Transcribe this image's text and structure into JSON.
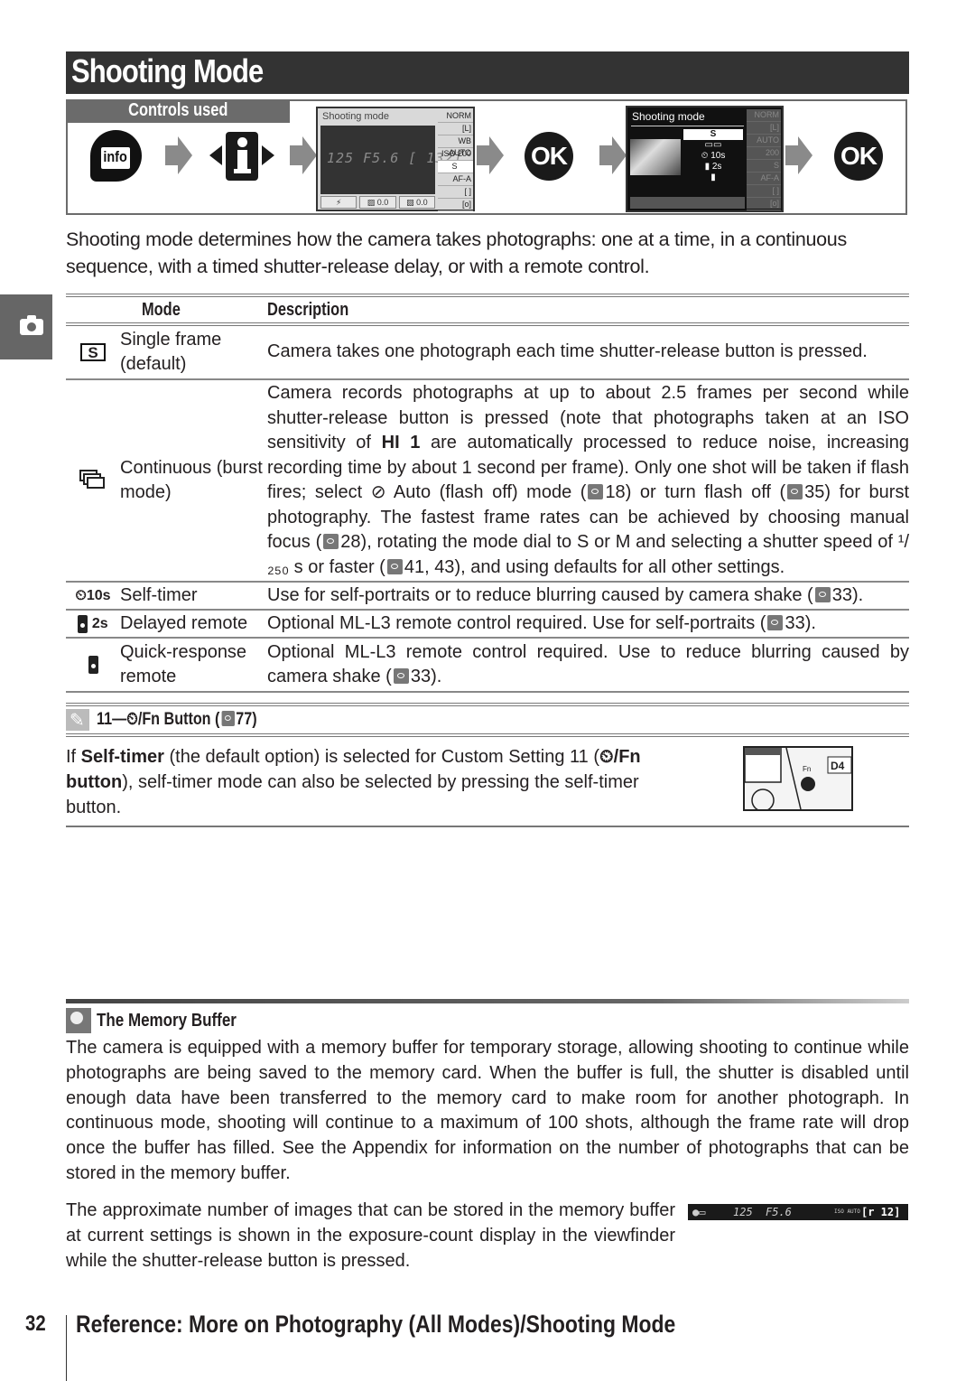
{
  "page": {
    "title": "Shooting Mode",
    "controls_label": "Controls used",
    "intro": "Shooting mode determines how the camera takes photographs: one at a time, in a continuous sequence, with a timed shutter-release delay, or with a remote control.",
    "side_tab_icon": "camera-icon"
  },
  "controls": {
    "info_button": "info",
    "ok_button_1": "OK",
    "ok_button_2": "OK",
    "screen1": {
      "header": "Shooting mode",
      "digits": "125  F5.6 [ 132]",
      "side": [
        "NORM",
        "[L]",
        "WB AUTO",
        "ISO 200",
        "S",
        "AF-A",
        "[ ]",
        "[o]"
      ],
      "bottom": [
        "⚡",
        "▨ 0.0",
        "▨ 0.0"
      ]
    },
    "screen2": {
      "header": "Shooting mode",
      "menu": [
        "S",
        "▭▭",
        "⏲ 10s",
        "▮ 2s",
        "▮"
      ],
      "side": [
        "NORM",
        "[L]",
        "AUTO",
        "200",
        "S",
        "AF-A",
        "[ ]",
        "[o]"
      ]
    }
  },
  "table": {
    "headers": {
      "mode": "Mode",
      "description": "Description"
    },
    "rows": [
      {
        "icon": "S",
        "icon_name": "single-frame-icon",
        "mode": "Single frame (default)",
        "description": "Camera takes one photograph each time shutter-release button is pressed."
      },
      {
        "icon": "",
        "icon_name": "continuous-icon",
        "mode": "Continuous (burst mode)",
        "description_parts": {
          "p1": "Camera records photographs at up to about 2.5 frames per second while shutter-release button is pressed (note that photographs taken at an ISO sensitivity of ",
          "bold1": "HI 1",
          "p2": " are automatically processed to reduce noise, increasing recording time by about 1 second per frame). Only one shot will be taken if flash fires; select ",
          "p3": " Auto (flash off) mode (",
          "ref1": "18",
          "p4": ") or turn flash off (",
          "ref2": "35",
          "p5": ") for burst photography. The fastest frame rates can be achieved by choosing manual focus (",
          "ref3": "28",
          "p6": "), rotating the mode dial to ",
          "s": "S",
          "p7": " or ",
          "m": "M",
          "p8": " and selecting a shutter speed of ",
          "speed": "¹/₂₅₀ s",
          "p9": " or faster (",
          "ref4": "41, 43",
          "p10": "), and using defaults for all other settings."
        }
      },
      {
        "icon": "⏲10s",
        "icon_name": "self-timer-icon",
        "mode": "Self-timer",
        "description": "Use for self-portraits or to reduce blurring caused by camera shake (",
        "ref": "33",
        "tail": ")."
      },
      {
        "icon": "2s",
        "icon_name": "delayed-remote-icon",
        "mode": "Delayed remote",
        "description": "Optional ML-L3 remote control required. Use for self-portraits (",
        "ref": "33",
        "tail": ")."
      },
      {
        "icon": "",
        "icon_name": "quick-response-remote-icon",
        "mode": "Quick-response remote",
        "description": "Optional ML-L3 remote control required. Use to reduce blurring caused by camera shake (",
        "ref": "33",
        "tail": ")."
      }
    ]
  },
  "note": {
    "title_prefix": "11—",
    "title_suffix": "/Fn Button (",
    "title_ref": "77",
    "title_end": ")",
    "body_p1": "If ",
    "body_bold1": "Self-timer",
    "body_p2": " (the default option) is selected for Custom Setting 11 (",
    "body_bold2": "⏲/Fn button",
    "body_p3": "), self-timer mode can also be selected by pressing the self-timer button."
  },
  "memory_buffer": {
    "title": "The Memory Buffer",
    "para1": "The camera is equipped with a memory buffer for temporary storage, allowing shooting to continue while photographs are being saved to the memory card. When the buffer is full, the shutter is disabled until enough data have been transferred to the memory card to make room for another photograph. In continuous mode, shooting will continue to a maximum of 100 shots, although the frame rate will drop once the buffer has filled. See the Appendix for information on the number of photographs that can be stored in the memory buffer.",
    "para2": "The approximate number of images that can be stored in the memory buffer at current settings is shown in the exposure-count display in the viewfinder while the shutter-release button is pressed.",
    "viewfinder": {
      "shutter": "125",
      "aperture": "F5.6",
      "iso": "ISO AUTO",
      "count": "[r 12]"
    }
  },
  "footer": {
    "page_number": "32",
    "title": "Reference: More on Photography (All Modes)/Shooting Mode"
  }
}
